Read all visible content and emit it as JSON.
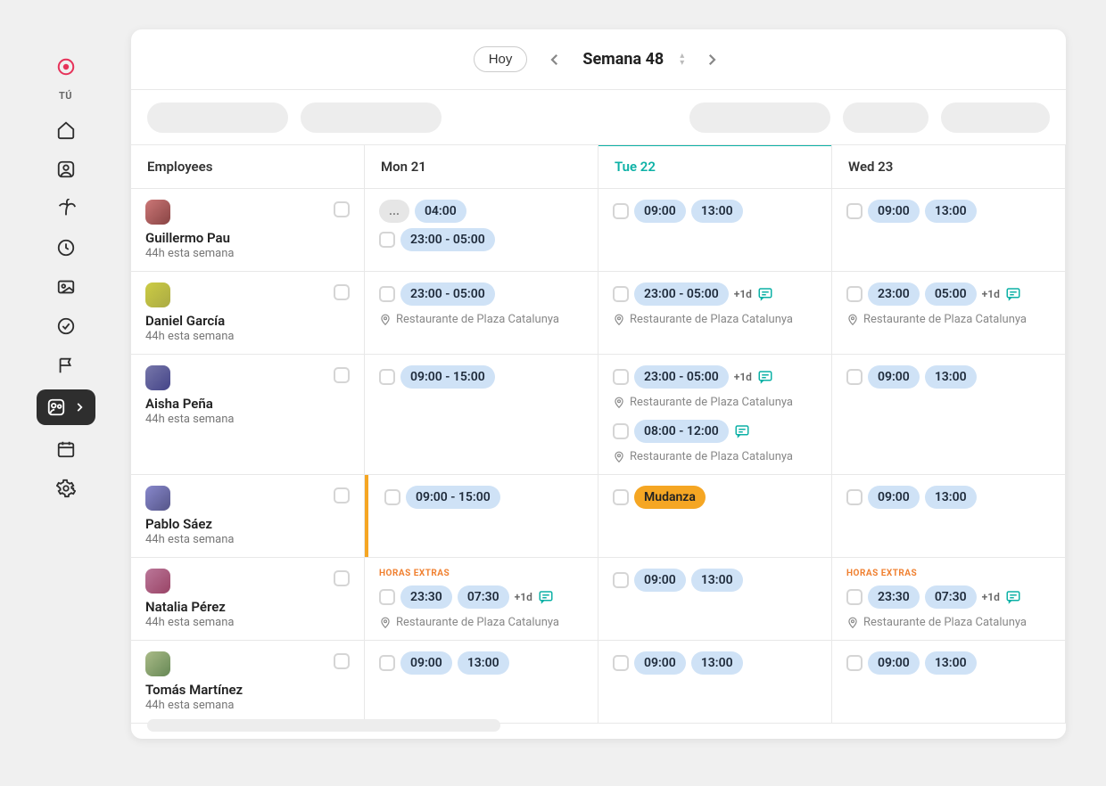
{
  "sidebar": {
    "tu_label": "TÚ"
  },
  "header": {
    "today_label": "Hoy",
    "week_label": "Semana 48"
  },
  "columns": {
    "employees": "Employees",
    "day0": "Mon 21",
    "day1": "Tue 22",
    "day2": "Wed 23"
  },
  "locations": {
    "plaza": "Restaurante de Plaza Catalunya"
  },
  "labels": {
    "horas_extras": "HORAS EXTRAS",
    "plus1d": "+1d",
    "ellipsis": "..."
  },
  "employees": [
    {
      "name": "Guillermo Pau",
      "sub": "44h esta semana"
    },
    {
      "name": "Daniel García",
      "sub": "44h esta semana"
    },
    {
      "name": "Aisha Peña",
      "sub": "44h esta semana"
    },
    {
      "name": "Pablo Sáez",
      "sub": "44h esta semana"
    },
    {
      "name": "Natalia Pérez",
      "sub": "44h esta semana"
    },
    {
      "name": "Tomás Martínez",
      "sub": "44h esta semana"
    }
  ],
  "shifts": {
    "r0": {
      "mon": {
        "a": "04:00",
        "b": "23:00 - 05:00"
      },
      "tue": {
        "a": "09:00",
        "b": "13:00"
      },
      "wed": {
        "a": "09:00",
        "b": "13:00"
      }
    },
    "r1": {
      "mon": {
        "a": "23:00 - 05:00"
      },
      "tue": {
        "a": "23:00 - 05:00"
      },
      "wed": {
        "a": "23:00",
        "b": "05:00"
      }
    },
    "r2": {
      "mon": {
        "a": "09:00 - 15:00"
      },
      "tue": {
        "a": "23:00 - 05:00",
        "b": "08:00 - 12:00"
      },
      "wed": {
        "a": "09:00",
        "b": "13:00"
      }
    },
    "r3": {
      "mon": {
        "a": "09:00 - 15:00"
      },
      "tue": {
        "a": "Mudanza"
      },
      "wed": {
        "a": "09:00",
        "b": "13:00"
      }
    },
    "r4": {
      "mon": {
        "a": "23:30",
        "b": "07:30"
      },
      "tue": {
        "a": "09:00",
        "b": "13:00"
      },
      "wed": {
        "a": "23:30",
        "b": "07:30"
      }
    },
    "r5": {
      "mon": {
        "a": "09:00",
        "b": "13:00"
      },
      "tue": {
        "a": "09:00",
        "b": "13:00"
      },
      "wed": {
        "a": "09:00",
        "b": "13:00"
      }
    }
  }
}
